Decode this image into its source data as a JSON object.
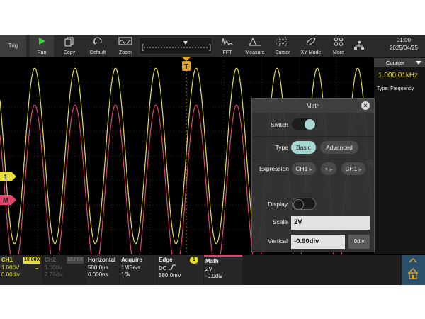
{
  "toolbar": {
    "trig": "Trig",
    "run": "Run",
    "copy": "Copy",
    "default": "Default",
    "zoom": "Zoom",
    "fft": "FFT",
    "measure": "Measure",
    "cursor": "Cursor",
    "xymode": "XY Mode",
    "more": "More",
    "time": "01:00",
    "date": "2025/04/25"
  },
  "markers": {
    "ch1": "1",
    "math": "M",
    "trigger": "T"
  },
  "counter": {
    "title": "Counter",
    "value": "1.000,01kHz",
    "type": "Type: Frequency"
  },
  "math": {
    "title": "Math",
    "switch_label": "Switch",
    "switch_on": true,
    "type_label": "Type",
    "type_basic": "Basic",
    "type_advanced": "Advanced",
    "expression_label": "Expression",
    "expr_src1": "CH1",
    "expr_op": "+",
    "expr_src2": "CH1",
    "display_label": "Display",
    "display_on": false,
    "scale_label": "Scale",
    "scale_value": "2V",
    "vertical_label": "Vertical",
    "vertical_value": "-0.90div",
    "zero_button": "0div"
  },
  "bottom": {
    "ch1": {
      "name": "CH1",
      "probe": "10.00X",
      "volts": "1.000V",
      "coupling": "=",
      "offset": "0.00div"
    },
    "ch2": {
      "name": "CH2",
      "probe": "10.00X",
      "volts": "1.000V",
      "offset": "2.76div"
    },
    "horizontal": {
      "name": "Horizontal",
      "timebase": "500.0µs",
      "delay": "0.000ns"
    },
    "acquire": {
      "name": "Acquire",
      "rate": "1MSa/s",
      "depth": "10k"
    },
    "trigger": {
      "name": "Edge",
      "source": "1",
      "coupling": "DC",
      "level": "580.0mV"
    },
    "math": {
      "name": "Math",
      "scale": "2V",
      "offset": "-0.9div"
    }
  },
  "colors": {
    "ch1": "#e6df3a",
    "math": "#e0436b",
    "accent": "#2f7fb8"
  }
}
